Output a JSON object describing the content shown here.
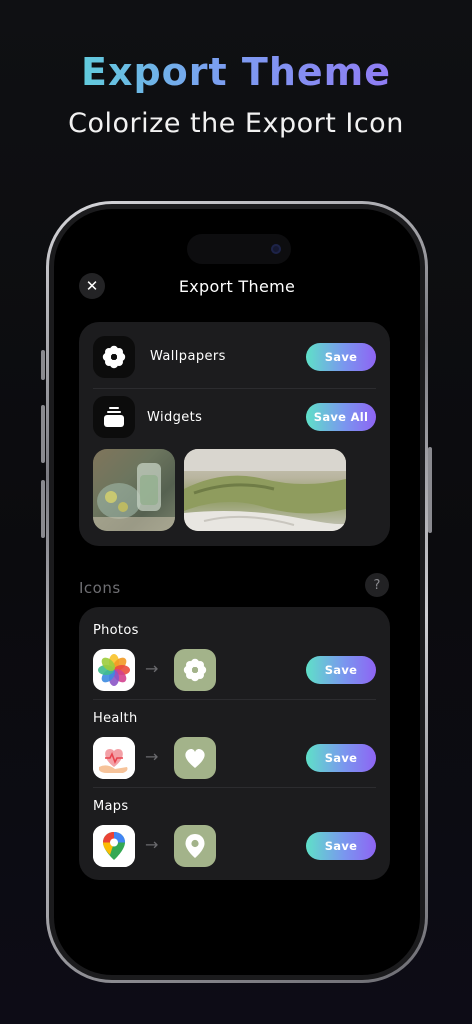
{
  "hero": {
    "title": "Export Theme",
    "subtitle": "Colorize the Export Icon"
  },
  "screen": {
    "title": "Export Theme",
    "close_symbol": "✕"
  },
  "export_card": {
    "wallpapers": {
      "label": "Wallpapers",
      "icon": "flower-icon",
      "button": "Save"
    },
    "widgets": {
      "label": "Widgets",
      "icon": "stack-icon",
      "button": "Save All"
    }
  },
  "icons_section": {
    "label": "Icons",
    "help_symbol": "?"
  },
  "apps": [
    {
      "name": "Photos",
      "original_icon": "photos-app-icon",
      "themed_icon": "flower-icon",
      "button": "Save"
    },
    {
      "name": "Health",
      "original_icon": "health-app-icon",
      "themed_icon": "heart-icon",
      "button": "Save"
    },
    {
      "name": "Maps",
      "original_icon": "maps-app-icon",
      "themed_icon": "location-pin-icon",
      "button": "Save"
    }
  ],
  "arrow_symbol": "→",
  "colors": {
    "accent_gradient_start": "#5fe0c8",
    "accent_gradient_end": "#8e64f3",
    "themed_icon_bg": "#a3b38a",
    "card_bg": "#1c1c1e"
  }
}
